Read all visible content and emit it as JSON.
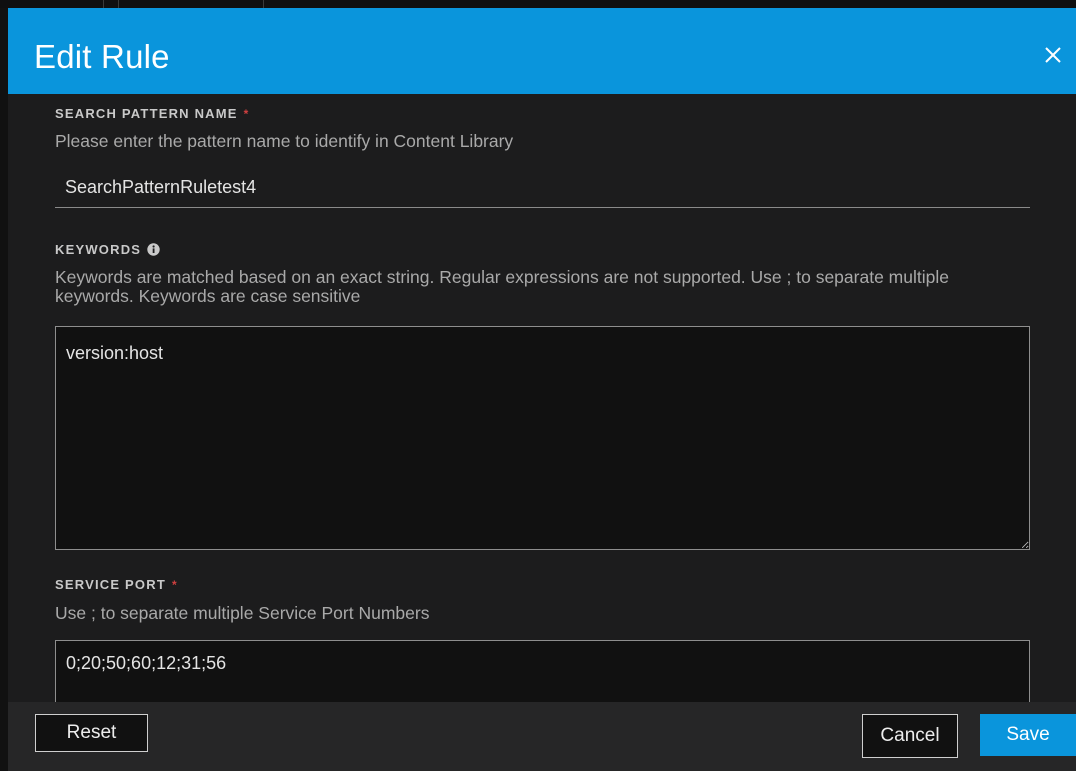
{
  "dialog": {
    "title": "Edit Rule",
    "close_icon": "close-icon"
  },
  "search_pattern": {
    "label": "SEARCH PATTERN NAME",
    "required_mark": "*",
    "help": "Please enter the pattern name to identify in Content Library",
    "value": "SearchPatternRuletest4"
  },
  "keywords": {
    "label": "KEYWORDS",
    "info_icon": "info-icon",
    "help": "Keywords are matched based on an exact string. Regular expressions are not supported. Use ; to separate multiple keywords. Keywords are case sensitive",
    "value": "version:host"
  },
  "service_port": {
    "label": "SERVICE PORT",
    "required_mark": "*",
    "help": "Use ; to separate multiple Service Port Numbers",
    "value": "0;20;50;60;12;31;56"
  },
  "footer": {
    "reset_label": "Reset",
    "cancel_label": "Cancel",
    "save_label": "Save"
  },
  "colors": {
    "accent": "#0a95dc",
    "required": "#d04040",
    "background": "#1c1c1d"
  }
}
